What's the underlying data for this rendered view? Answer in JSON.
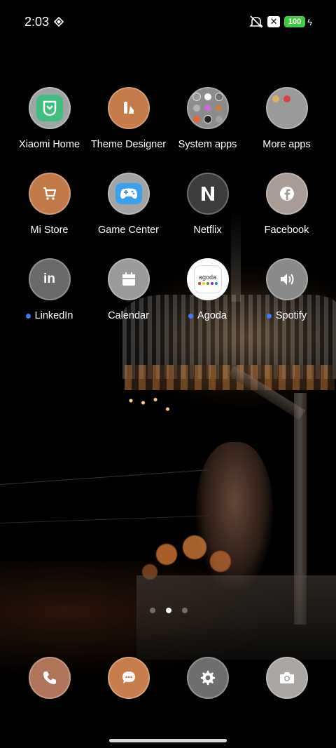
{
  "status_bar": {
    "time": "2:03",
    "battery": "100",
    "charging_symbol": "ϟ",
    "notification_icons": [
      "diamond-icon",
      "mute-icon",
      "x-notification-icon"
    ]
  },
  "apps": [
    {
      "label": "Xiaomi Home",
      "icon": "mi-home-icon",
      "bg": "#9a9fa0",
      "notify": false
    },
    {
      "label": "Theme Designer",
      "icon": "theme-designer-icon",
      "bg": "#c57b4a",
      "notify": false
    },
    {
      "label": "System apps",
      "icon": "folder-icon",
      "bg": "#8c8c8c",
      "notify": false
    },
    {
      "label": "More apps",
      "icon": "folder-icon",
      "bg": "#9a9a9a",
      "notify": false
    },
    {
      "label": "Mi Store",
      "icon": "cart-icon",
      "bg": "#c27a48",
      "notify": false
    },
    {
      "label": "Game Center",
      "icon": "gamepad-icon",
      "bg": "#a3a3a3",
      "notify": false
    },
    {
      "label": "Netflix",
      "icon": "netflix-icon",
      "bg": "#3c3c3c",
      "notify": false
    },
    {
      "label": "Facebook",
      "icon": "facebook-icon",
      "bg": "#a99b96",
      "notify": false
    },
    {
      "label": "LinkedIn",
      "icon": "linkedin-icon",
      "bg": "#6a6a6a",
      "notify": true
    },
    {
      "label": "Calendar",
      "icon": "calendar-icon",
      "bg": "#9a9a9a",
      "notify": false
    },
    {
      "label": "Agoda",
      "icon": "agoda-icon",
      "bg": "#ffffff",
      "notify": true
    },
    {
      "label": "Spotify",
      "icon": "speaker-icon",
      "bg": "#8a8a8a",
      "notify": true
    }
  ],
  "agoda_logo_text": "agoda",
  "folder_contents": {
    "system_apps": [
      "#9a9a9a",
      "#ffffff",
      "#9a9a9a",
      "#b3b3b3",
      "#c36fd8",
      "#c2824e",
      "#e06a3b",
      "#222222",
      "#a0a0a0"
    ],
    "more_apps": [
      "#e0b060",
      "#d94040"
    ]
  },
  "pager": {
    "pages": 3,
    "current": 1
  },
  "dock": [
    {
      "name": "phone",
      "icon": "phone-icon",
      "bg": "#b07558"
    },
    {
      "name": "messages",
      "icon": "message-icon",
      "bg": "#c87e4c"
    },
    {
      "name": "settings",
      "icon": "gear-icon",
      "bg": "#6e6e6e"
    },
    {
      "name": "camera",
      "icon": "camera-icon",
      "bg": "#a9a6a4"
    }
  ]
}
